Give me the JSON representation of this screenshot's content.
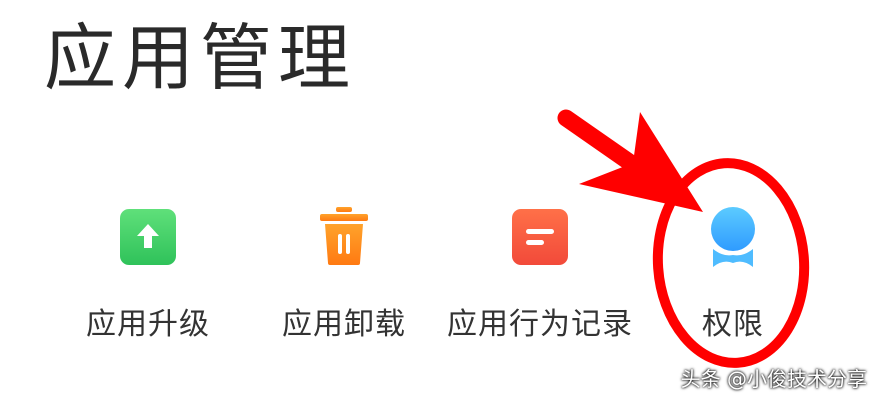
{
  "header": {
    "title": "应用管理"
  },
  "tiles": [
    {
      "label": "应用升级",
      "icon": "arrow-up-icon",
      "color": "#4cd964"
    },
    {
      "label": "应用卸载",
      "icon": "trash-icon",
      "color": "#ff8c1a"
    },
    {
      "label": "应用行为记录",
      "icon": "record-icon",
      "color": "#ff5a3c"
    },
    {
      "label": "权限",
      "icon": "badge-icon",
      "color": "#3aa8ff"
    }
  ],
  "annotation": {
    "color": "#ff0000"
  },
  "watermark": {
    "text": "头条 @小俊技术分享"
  }
}
